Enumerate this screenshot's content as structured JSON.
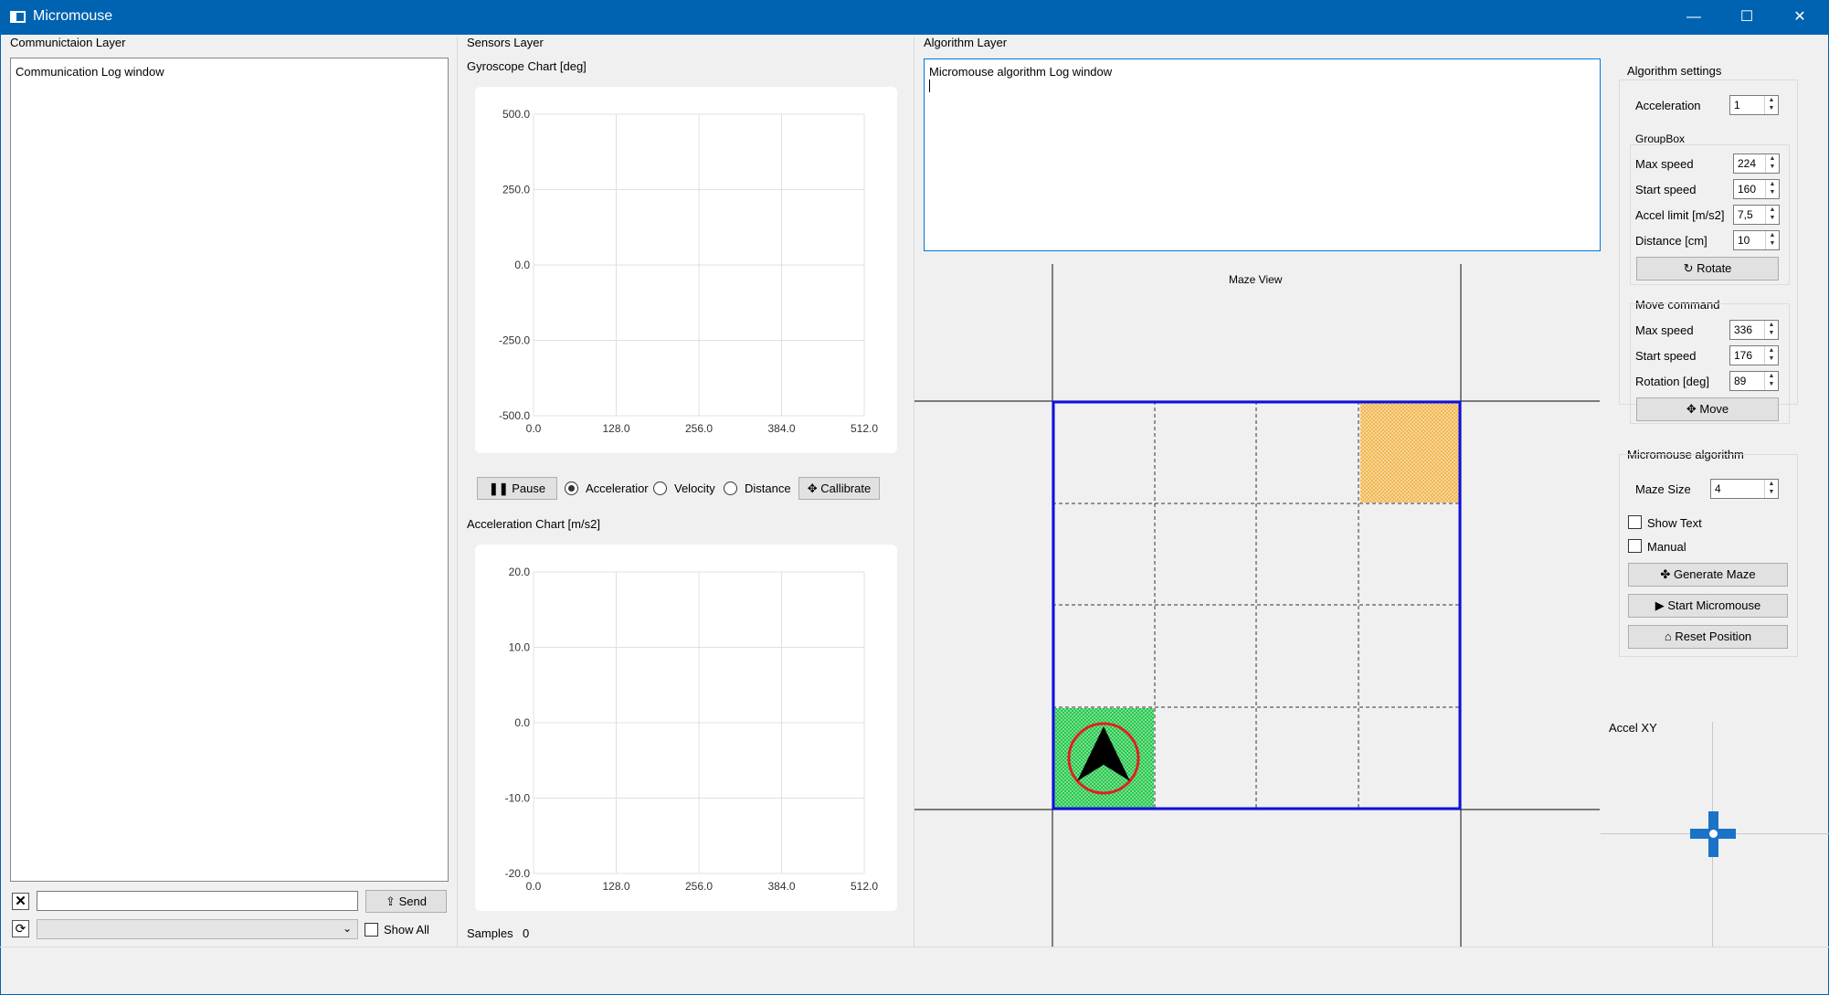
{
  "window": {
    "title": "Micromouse",
    "minimize": "—",
    "maximize": "☐",
    "close": "✕"
  },
  "comm": {
    "title": "Communictaion Layer",
    "log_text": "Communication Log window",
    "input_value": "",
    "send_label": "Send",
    "show_all_label": "Show All",
    "port_value": ""
  },
  "sensors": {
    "title": "Sensors Layer",
    "gyro_title": "Gyroscope Chart [deg]",
    "accel_title": "Acceleration Chart [m/s2]",
    "pause_label": "Pause",
    "radio_acceleration": "Acceleratior",
    "radio_velocity": "Velocity",
    "radio_distance": "Distance",
    "calibrate_label": "Callibrate",
    "samples_label": "Samples",
    "samples_value": "0"
  },
  "chart_data": [
    {
      "type": "line",
      "title": "Gyroscope Chart [deg]",
      "x_ticks": [
        "0.0",
        "128.0",
        "256.0",
        "384.0",
        "512.0"
      ],
      "y_ticks": [
        "500.0",
        "250.0",
        "0.0",
        "-250.0",
        "-500.0"
      ],
      "xlim": [
        0,
        512
      ],
      "ylim": [
        -500,
        500
      ],
      "grid": true,
      "series": []
    },
    {
      "type": "line",
      "title": "Acceleration Chart [m/s2]",
      "x_ticks": [
        "0.0",
        "128.0",
        "256.0",
        "384.0",
        "512.0"
      ],
      "y_ticks": [
        "20.0",
        "10.0",
        "0.0",
        "-10.0",
        "-20.0"
      ],
      "xlim": [
        0,
        512
      ],
      "ylim": [
        -20,
        20
      ],
      "grid": true,
      "series": []
    }
  ],
  "algorithm": {
    "title": "Algorithm Layer",
    "log_text": "Micromouse algorithm Log window",
    "maze_view_label": "Maze View",
    "maze_size": 4,
    "start_cell_color": "#22c55e",
    "goal_cell_color": "#f5a623",
    "wall_color": "#1010e0"
  },
  "settings": {
    "title": "Algorithm settings",
    "acceleration_label": "Acceleration",
    "acceleration_value": "1",
    "groupbox_title": "GroupBox",
    "max_speed_label": "Max speed",
    "max_speed_value": "224",
    "start_speed_label": "Start speed",
    "start_speed_value": "160",
    "accel_limit_label": "Accel limit [m/s2]",
    "accel_limit_value": "7,5",
    "distance_label": "Distance [cm]",
    "distance_value": "10",
    "rotate_label": "Rotate",
    "move_title": "Move command",
    "move_max_speed_label": "Max speed",
    "move_max_speed_value": "336",
    "move_start_speed_label": "Start speed",
    "move_start_speed_value": "176",
    "rotation_label": "Rotation [deg]",
    "rotation_value": "89",
    "move_label": "Move"
  },
  "micromouse": {
    "title": "Micromouse algorithm",
    "maze_size_label": "Maze Size",
    "maze_size_value": "4",
    "show_text_label": "Show Text",
    "manual_label": "Manual",
    "generate_label": "Generate Maze",
    "start_label": "Start Micromouse",
    "reset_label": "Reset Position"
  },
  "accel_xy": {
    "title": "Accel XY"
  }
}
